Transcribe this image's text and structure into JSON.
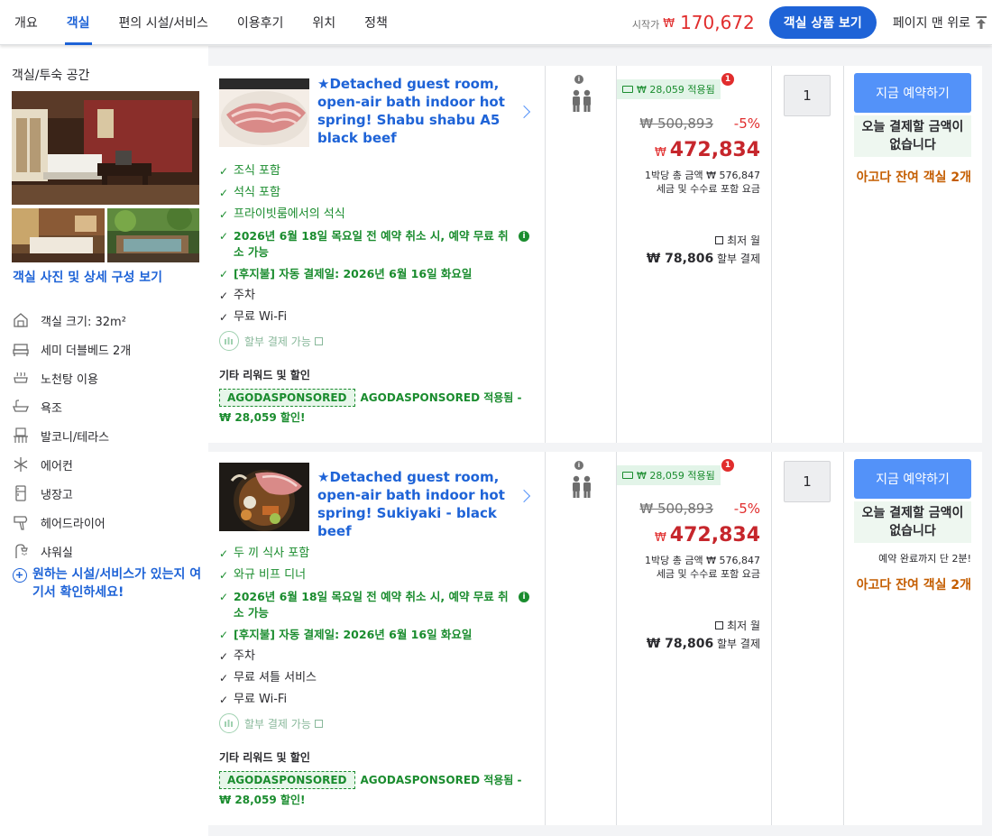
{
  "nav": {
    "tabs": [
      "개요",
      "객실",
      "편의 시설/서비스",
      "이용후기",
      "위치",
      "정책"
    ],
    "start_label": "시작가",
    "currency": "₩",
    "start_price": "170,672",
    "view_rooms": "객실 상품 보기",
    "back_top": "페이지 맨 위로"
  },
  "left": {
    "title": "객실/투숙 공간",
    "photo_link": "객실 사진 및 상세 구성 보기",
    "features": [
      {
        "icon": "room-size-icon",
        "label": "객실 크기: 32m²"
      },
      {
        "icon": "bed-icon",
        "label": "세미 더블베드 2개"
      },
      {
        "icon": "outdoor-bath-icon",
        "label": "노천탕 이용"
      },
      {
        "icon": "bathtub-icon",
        "label": "욕조"
      },
      {
        "icon": "balcony-icon",
        "label": "발코니/테라스"
      },
      {
        "icon": "snowflake-icon",
        "label": "에어컨"
      },
      {
        "icon": "fridge-icon",
        "label": "냉장고"
      },
      {
        "icon": "hairdryer-icon",
        "label": "헤어드라이어"
      },
      {
        "icon": "shower-icon",
        "label": "샤워실"
      }
    ],
    "more_facilities": "원하는 시설/서비스가 있는지 여기서 확인하세요!"
  },
  "rooms": [
    {
      "title": "★Detached guest room, open-air bath indoor hot spring! Shabu shabu A5 black beef",
      "benefits": [
        {
          "text": "조식 포함",
          "style": "green"
        },
        {
          "text": "석식 포함",
          "style": "green"
        },
        {
          "text": "프라이빗룸에서의 석식",
          "style": "green"
        },
        {
          "text": "2026년 6월 18일 목요일 전 예약 취소 시, 예약 무료 취소 가능",
          "style": "green bold",
          "info": true
        },
        {
          "text": "[후지불] 자동 결제일: 2026년 6월 16일 화요일",
          "style": "green bold"
        },
        {
          "text": "주차",
          "style": "black"
        },
        {
          "text": "무료 Wi-Fi",
          "style": "black"
        }
      ],
      "installment": "할부 결제 가능",
      "other_title": "기타 리워드 및 할인",
      "sponsor_tag": "AGODASPONSORED",
      "sponsor_text": "AGODASPONSORED 적용됨 - ₩ 28,059 할인!",
      "promo": "₩ 28,059 적용됨",
      "promo_count": "1",
      "old_price": "₩ 500,893",
      "discount": "-5%",
      "currency": "₩",
      "price": "472,834",
      "per_night": "1박당 총 금액 ₩ 576,847",
      "incl_tax": "세금 및 수수료 포함 요금",
      "lowest": "최저 월",
      "installment_price": "₩ 78,806",
      "installment_suffix": "할부 결제",
      "qty": "1",
      "book": "지금 예약하기",
      "pay_now": "오늘 결제할 금액이 없습니다",
      "deadline": "",
      "rooms_left": "아고다 잔여 객실 2개"
    },
    {
      "title": "★Detached guest room, open-air bath indoor hot spring! Sukiyaki - black beef",
      "benefits": [
        {
          "text": "두 끼 식사 포함",
          "style": "green"
        },
        {
          "text": "와규 비프 디너",
          "style": "green"
        },
        {
          "text": "2026년 6월 18일 목요일 전 예약 취소 시, 예약 무료 취소 가능",
          "style": "green bold",
          "info": true
        },
        {
          "text": "[후지불] 자동 결제일: 2026년 6월 16일 화요일",
          "style": "green bold"
        },
        {
          "text": "주차",
          "style": "black"
        },
        {
          "text": "무료 셔틀 서비스",
          "style": "black"
        },
        {
          "text": "무료 Wi-Fi",
          "style": "black"
        }
      ],
      "installment": "할부 결제 가능",
      "other_title": "기타 리워드 및 할인",
      "sponsor_tag": "AGODASPONSORED",
      "sponsor_text": "AGODASPONSORED 적용됨 - ₩ 28,059 할인!",
      "promo": "₩ 28,059 적용됨",
      "promo_count": "1",
      "old_price": "₩ 500,893",
      "discount": "-5%",
      "currency": "₩",
      "price": "472,834",
      "per_night": "1박당 총 금액 ₩ 576,847",
      "incl_tax": "세금 및 수수료 포함 요금",
      "lowest": "최저 월",
      "installment_price": "₩ 78,806",
      "installment_suffix": "할부 결제",
      "qty": "1",
      "book": "지금 예약하기",
      "pay_now": "오늘 결제할 금액이 없습니다",
      "deadline": "예약 완료까지 단 2분!",
      "rooms_left": "아고다 잔여 객실 2개"
    }
  ],
  "colors": {
    "accent": "#1e63d7",
    "price": "#c6262c",
    "benefit": "#1a8c2e",
    "rooms_left": "#c45d00"
  }
}
